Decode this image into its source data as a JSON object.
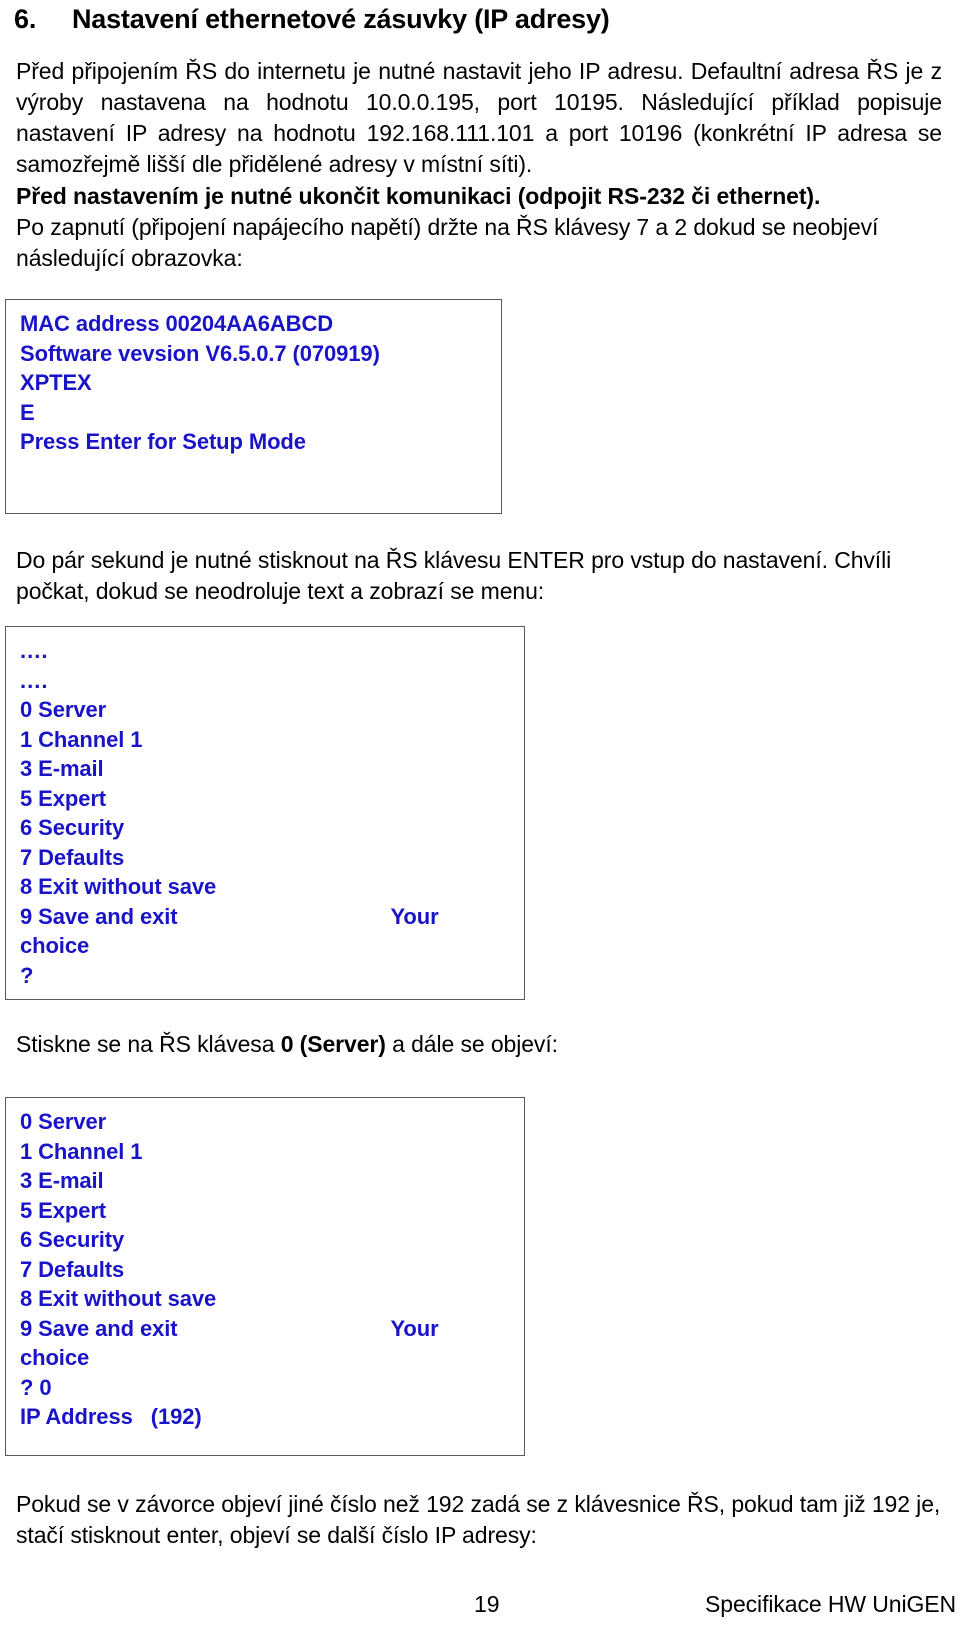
{
  "document": {
    "heading": {
      "number": "6.",
      "title": "Nastavení ethernetové zásuvky (IP adresy)"
    },
    "paragraphs": {
      "intro": "Před připojením ŘS do internetu je nutné nastavit jeho IP adresu. Defaultní adresa ŘS je z výroby nastavena na hodnotu 10.0.0.195, port 10195. Následující příklad popisuje nastavení IP adresy na hodnotu 192.168.111.101 a port 10196 (konkrétní IP adresa se samozřejmě lišší dle přidělené adresy v místní síti).",
      "warning_bold": "Před nastavením je nutné ukončit komunikaci (odpojit RS-232 či ethernet).",
      "power_on": "Po zapnutí (připojení napájecího napětí) držte na ŘS klávesy 7 a 2 dokud se neobjeví následující obrazovka:",
      "press_enter": "Do pár sekund je nutné stisknout na ŘS klávesu ENTER pro vstup do nastavení. Chvíli počkat, dokud se neodroluje text a zobrazí se menu:",
      "press_zero_pre": "Stiskne se na ŘS klávesa ",
      "press_zero_bold": "0 (Server)",
      "press_zero_post": " a dále se objeví:",
      "closing": "Pokud se v závorce objeví jiné číslo než 192 zadá se z klávesnice ŘS, pokud tam již 192 je, stačí stisknout enter, objeví se další číslo IP adresy:"
    },
    "terminal_boot": {
      "text_color": "#1a14c8",
      "border_color": "#595959",
      "lines": [
        "MAC address 00204AA6ABCD",
        "Software vevsion V6.5.0.7 (070919)",
        "XPTEX",
        "E",
        "Press Enter for Setup Mode",
        "",
        ""
      ]
    },
    "terminal_menu_1": {
      "text_color": "#1a14c8",
      "border_color": "#595959",
      "lines": [
        "....",
        "....",
        "0 Server",
        "1 Channel 1",
        "3 E-mail",
        "5 Expert",
        "6 Security",
        "7 Defaults",
        "8 Exit without save",
        "9 Save and exit",
        "choice",
        "?"
      ],
      "right_column_label": "Your",
      "right_column_line_index": 9
    },
    "terminal_menu_2": {
      "text_color": "#1a14c8",
      "border_color": "#595959",
      "lines": [
        "0 Server",
        "1 Channel 1",
        "3 E-mail",
        "5 Expert",
        "6 Security",
        "7 Defaults",
        "8 Exit without save",
        "9 Save and exit",
        "choice",
        "? 0",
        "IP Address   (192)"
      ],
      "right_column_label": "Your",
      "right_column_line_index": 7
    },
    "footer": {
      "page_number": "19",
      "doc_reference": "Specifikace HW UniGEN"
    }
  }
}
